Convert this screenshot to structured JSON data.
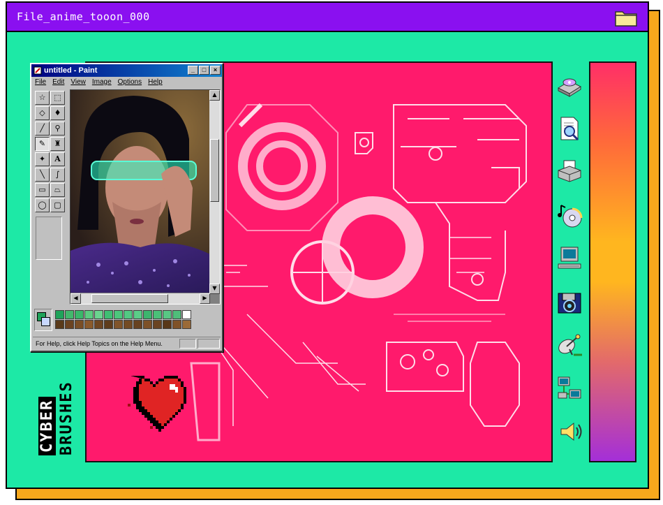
{
  "window": {
    "title": "File_anime_tooon_000"
  },
  "paint": {
    "title": "untitled - Paint",
    "menu": [
      "File",
      "Edit",
      "View",
      "Image",
      "Options",
      "Help"
    ],
    "window_buttons": [
      "_",
      "□",
      "×"
    ],
    "status_text": "For Help, click Help Topics on the Help Menu."
  },
  "brand": {
    "line1": "CYBER",
    "line2": "BRUSHES"
  },
  "desktop_icons": [
    "disc-drive-icon",
    "find-document-icon",
    "printer-icon",
    "music-cd-icon",
    "computer-icon",
    "camera-disk-icon",
    "satellite-icon",
    "network-icon",
    "speaker-icon"
  ],
  "palette_colors": [
    "#1fa35a",
    "#42b86c",
    "#3ab86a",
    "#5ccc80",
    "#6bd48f",
    "#3fbf73",
    "#4cc77c",
    "#52c983",
    "#5bcd88",
    "#3db56e",
    "#4ac078",
    "#58c784",
    "#4fbd7a",
    "#ffffff",
    "#5a3a1a",
    "#6b4321",
    "#7a4e26",
    "#8a5a2c",
    "#6e4622",
    "#5e3c1c",
    "#80542a",
    "#734b24",
    "#674220",
    "#7d5128",
    "#6a4422",
    "#583718",
    "#7f5229",
    "#9a6a38"
  ],
  "colors": {
    "teal": "#1de9a6",
    "purple": "#8a10f0",
    "orange": "#f7a81c",
    "pink": "#ff1a6c"
  }
}
